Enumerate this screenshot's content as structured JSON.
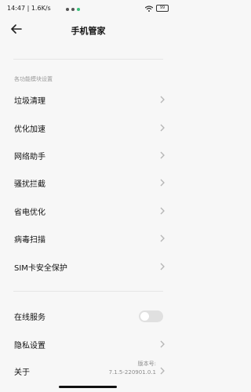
{
  "status_bar": {
    "time": "14:47",
    "net_speed": "1.6K/s",
    "battery": "99"
  },
  "header": {
    "title": "手机管家"
  },
  "section_label": "各功能模块设置",
  "menu_items": [
    {
      "label": "垃圾清理"
    },
    {
      "label": "优化加速"
    },
    {
      "label": "网络助手"
    },
    {
      "label": "骚扰拦截"
    },
    {
      "label": "省电优化"
    },
    {
      "label": "病毒扫描"
    },
    {
      "label": "SIM卡安全保护"
    }
  ],
  "online_service": {
    "label": "在线服务",
    "enabled": false
  },
  "privacy": {
    "label": "隐私设置"
  },
  "about": {
    "label": "关于",
    "version_label": "版本号:",
    "version_value": "7.1.5-220901.0.1"
  },
  "colors": {
    "background": "#f7f7f7",
    "divider": "#e6e6e6",
    "toggle_off": "#e0e0e0"
  },
  "icons": [
    "back-arrow-icon",
    "chevron-right-icon",
    "wifi-icon",
    "battery-icon"
  ]
}
